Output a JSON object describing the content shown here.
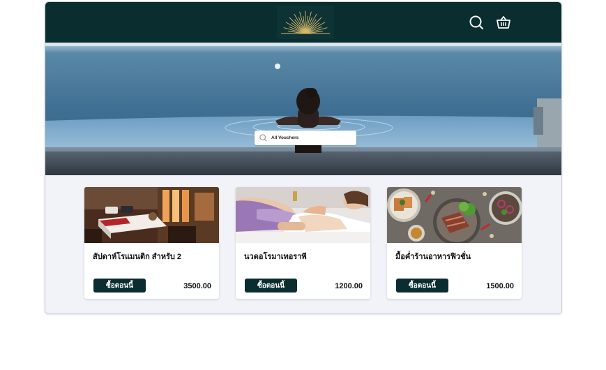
{
  "header": {
    "logo": "sunburst-logo",
    "icons": [
      "search-icon",
      "basket-icon"
    ]
  },
  "hero": {
    "search_placeholder": "All Vouchers"
  },
  "vouchers": [
    {
      "title": "สัปดาห์โรแมนติก สำหรับ 2",
      "button": "ซื้อตอนนี้",
      "price": "3500.00",
      "image": "hotel-room"
    },
    {
      "title": "นวดอโรมาเทอราพี",
      "button": "ซื้อตอนนี้",
      "price": "1200.00",
      "image": "massage"
    },
    {
      "title": "มื้อค่ำร้านอาหารฟิวชั่น",
      "button": "ซื้อตอนนี้",
      "price": "1500.00",
      "image": "food-dishes"
    }
  ],
  "colors": {
    "header": "#0a2d2f",
    "button": "#0a2d2f",
    "content_bg": "#f1f3f8",
    "logo_gold": "#d8b86a"
  }
}
